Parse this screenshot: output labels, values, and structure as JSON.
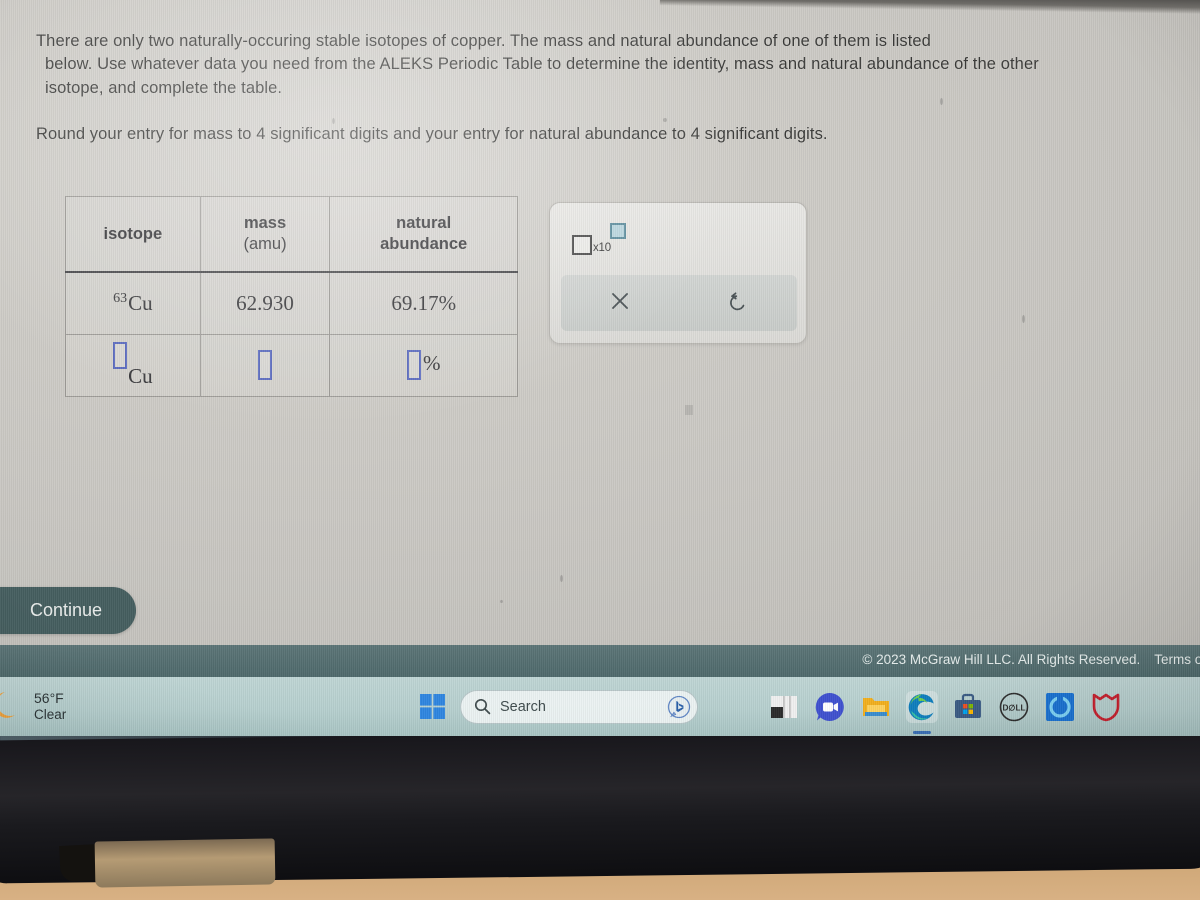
{
  "exercise": {
    "prompt_line1": "There are only two naturally-occuring stable isotopes of copper. The mass and natural abundance of one of them is listed",
    "prompt_line2": "below. Use whatever data you need from the ALEKS Periodic Table to determine the identity, mass and natural abundance of the other",
    "prompt_line3": "isotope, and complete the table.",
    "prompt_line4": "Round your entry for mass to 4 significant digits and your entry for natural abundance to 4 significant digits."
  },
  "table": {
    "headers": {
      "isotope": "isotope",
      "mass": "mass",
      "mass_unit": "(amu)",
      "abundance_line1": "natural",
      "abundance_line2": "abundance"
    },
    "rows": [
      {
        "isotope_superscript": "63",
        "isotope_symbol": "Cu",
        "mass": "62.930",
        "abundance": "69.17%"
      },
      {
        "isotope_superscript": "",
        "isotope_symbol": "Cu",
        "mass": "",
        "abundance": "",
        "abundance_suffix": "%"
      }
    ]
  },
  "toolbar": {
    "sci_notation_label": "x10",
    "clear_icon": "close-x-icon",
    "undo_icon": "undo-arrow-icon"
  },
  "continue_button": {
    "label": "Continue"
  },
  "footer": {
    "copyright": "© 2023 McGraw Hill LLC. All Rights Reserved.",
    "terms": "Terms of"
  },
  "taskbar": {
    "weather": {
      "temperature": "56°F",
      "condition": "Clear",
      "icon": "crescent-moon-icon"
    },
    "search": {
      "placeholder": "Search",
      "icon": "search-icon",
      "assistant_icon": "bing-chat-icon"
    },
    "start_icon": "windows-start-icon",
    "apps": [
      {
        "name": "task-view",
        "label": "Task View"
      },
      {
        "name": "zoom",
        "label": "Zoom"
      },
      {
        "name": "file-explorer",
        "label": "File Explorer"
      },
      {
        "name": "microsoft-edge",
        "label": "Microsoft Edge",
        "active": true
      },
      {
        "name": "microsoft-store",
        "label": "Microsoft Store"
      },
      {
        "name": "dell",
        "label": "Dell"
      },
      {
        "name": "alexa",
        "label": "Alexa"
      },
      {
        "name": "mcafee",
        "label": "McAfee"
      }
    ]
  },
  "colors": {
    "input_box_border": "#5b6bbf",
    "continue_bg": "#455e5f",
    "footer_bg": "#536f71",
    "taskbar_bg": "#b6cfce",
    "sci_exponent_fill": "#b9d6de"
  }
}
